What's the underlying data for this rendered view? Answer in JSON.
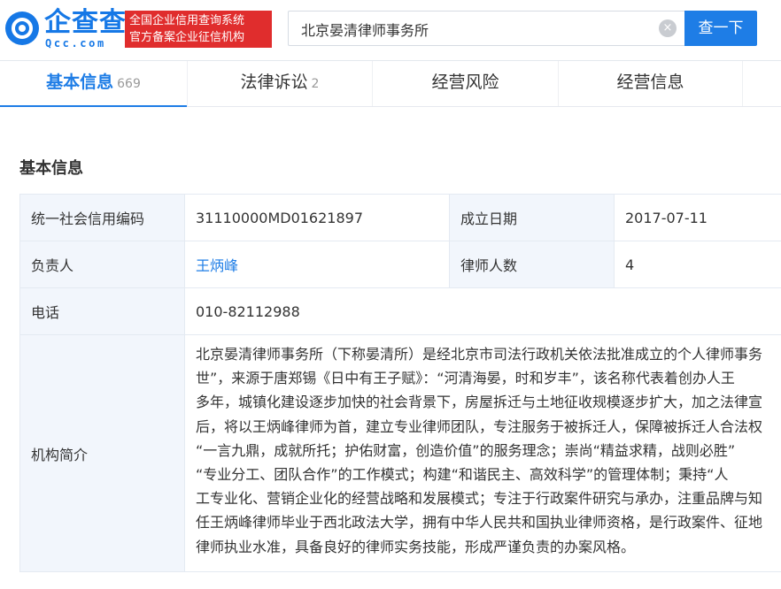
{
  "header": {
    "logo_text": "企查查",
    "logo_sub": "Qcc.com",
    "slogan_line1": "全国企业信用查询系统",
    "slogan_line2": "官方备案企业征信机构",
    "search_value": "北京晏清律师事务所",
    "search_button": "查一下",
    "clear_icon": "×"
  },
  "tabs": [
    {
      "label": "基本信息",
      "count": "669",
      "active": true
    },
    {
      "label": "法律诉讼",
      "count": "2",
      "active": false
    },
    {
      "label": "经营风险",
      "count": "",
      "active": false
    },
    {
      "label": "经营信息",
      "count": "",
      "active": false
    }
  ],
  "section_title": "基本信息",
  "info": {
    "credit_code_label": "统一社会信用编码",
    "credit_code_value": "31110000MD01621897",
    "founded_label": "成立日期",
    "founded_value": "2017-07-11",
    "leader_label": "负责人",
    "leader_value": "王炳峰",
    "lawyers_label": "律师人数",
    "lawyers_value": "4",
    "phone_label": "电话",
    "phone_value": "010-82112988",
    "intro_label": "机构简介",
    "intro_lines": [
      "北京晏清律师事务所（下称晏清所）是经北京市司法行政机关依法批准成立的个人律师事务",
      "世”，来源于唐郑锡《日中有王子赋》：“河清海晏，时和岁丰”，该名称代表着创办人王",
      "多年，城镇化建设逐步加快的社会背景下，房屋拆迁与土地征收规模逐步扩大，加之法律宣",
      "后，将以王炳峰律师为首，建立专业律师团队，专注服务于被拆迁人，保障被拆迁人合法权",
      "“一言九鼎，成就所托；护佑财富，创造价值”的服务理念；崇尚“精益求精，战则必胜”",
      "“专业分工、团队合作”的工作模式；构建“和谐民主、高效科学”的管理体制；秉持“人",
      "工专业化、营销企业化的经营战略和发展模式；专注于行政案件研究与承办，注重品牌与知",
      "任王炳峰律师毕业于西北政法大学，拥有中华人民共和国执业律师资格，是行政案件、征地",
      "律师执业水准，具备良好的律师实务技能，形成严谨负责的办案风格。"
    ]
  },
  "colors": {
    "brand_blue": "#1e7de6",
    "slogan_red": "#e02d2d",
    "label_bg": "#f2f6fc"
  }
}
